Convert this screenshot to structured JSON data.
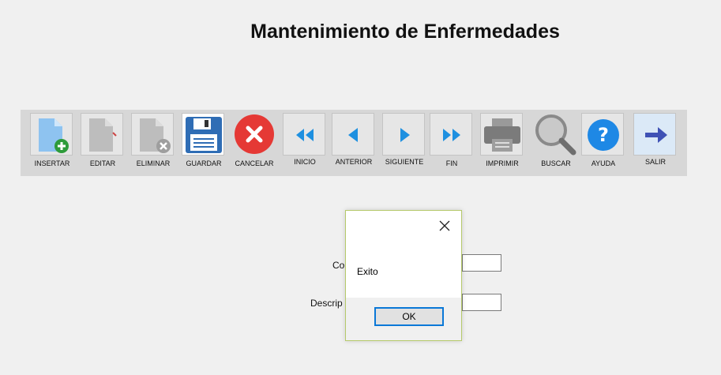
{
  "window": {
    "title": "Mantenimiento de Enfermedades"
  },
  "toolbar": {
    "buttons": [
      {
        "label": "INSERTAR",
        "icon": "document-add-icon"
      },
      {
        "label": "EDITAR",
        "icon": "document-edit-icon"
      },
      {
        "label": "ELIMINAR",
        "icon": "document-delete-icon"
      },
      {
        "label": "GUARDAR",
        "icon": "floppy-disk-icon"
      },
      {
        "label": "CANCELAR",
        "icon": "cancel-x-icon"
      },
      {
        "label": "INICIO",
        "icon": "first-record-icon"
      },
      {
        "label": "ANTERIOR",
        "icon": "previous-record-icon"
      },
      {
        "label": "SIGUIENTE",
        "icon": "next-record-icon"
      },
      {
        "label": "FIN",
        "icon": "last-record-icon"
      },
      {
        "label": "IMPRIMIR",
        "icon": "printer-icon"
      },
      {
        "label": "BUSCAR",
        "icon": "magnifier-icon"
      },
      {
        "label": "AYUDA",
        "icon": "help-icon"
      },
      {
        "label": "SALIR",
        "icon": "exit-arrow-icon"
      }
    ]
  },
  "form": {
    "codigo_label": "Co",
    "descripcion_label": "Descrip",
    "codigo_value": "",
    "descripcion_value": ""
  },
  "dialog": {
    "message": "Exito",
    "ok_label": "OK",
    "close_glyph": "✕"
  },
  "colors": {
    "toolbar_bg": "#d7d7d7",
    "accent_blue": "#1e90e0",
    "cancel_red": "#e53935",
    "ok_border": "#0a78d7"
  }
}
